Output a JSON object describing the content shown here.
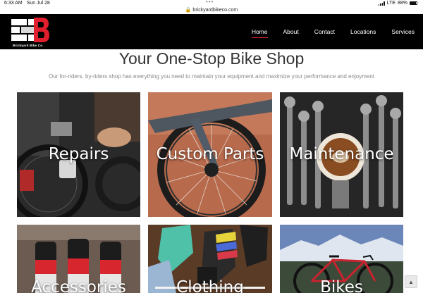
{
  "status_bar": {
    "time": "6:33 AM",
    "date": "Sun Jul 28",
    "network": "LTE",
    "battery": "88%",
    "url": "brickyardbikeco.com"
  },
  "header": {
    "logo_text": "Brickyard Bike Co.",
    "nav": [
      {
        "label": "Home",
        "active": true
      },
      {
        "label": "About"
      },
      {
        "label": "Contact"
      },
      {
        "label": "Locations"
      },
      {
        "label": "Services"
      }
    ]
  },
  "hero": {
    "title": "Your One-Stop Bike Shop",
    "subtitle": "Our for-riders, by-riders shop has everything you need to maintain your equipment and maximize your performance and enjoyment"
  },
  "tiles": [
    {
      "label": "Repairs"
    },
    {
      "label": "Custom Parts"
    },
    {
      "label": "Maintenance"
    },
    {
      "label": "Accessories"
    },
    {
      "label": "Clothing"
    },
    {
      "label": "Bikes"
    }
  ],
  "colors": {
    "brand_red": "#e01e2d",
    "nav_bg": "#000000",
    "headline": "#333333"
  },
  "scroll_top_icon": "arrow-up-icon"
}
